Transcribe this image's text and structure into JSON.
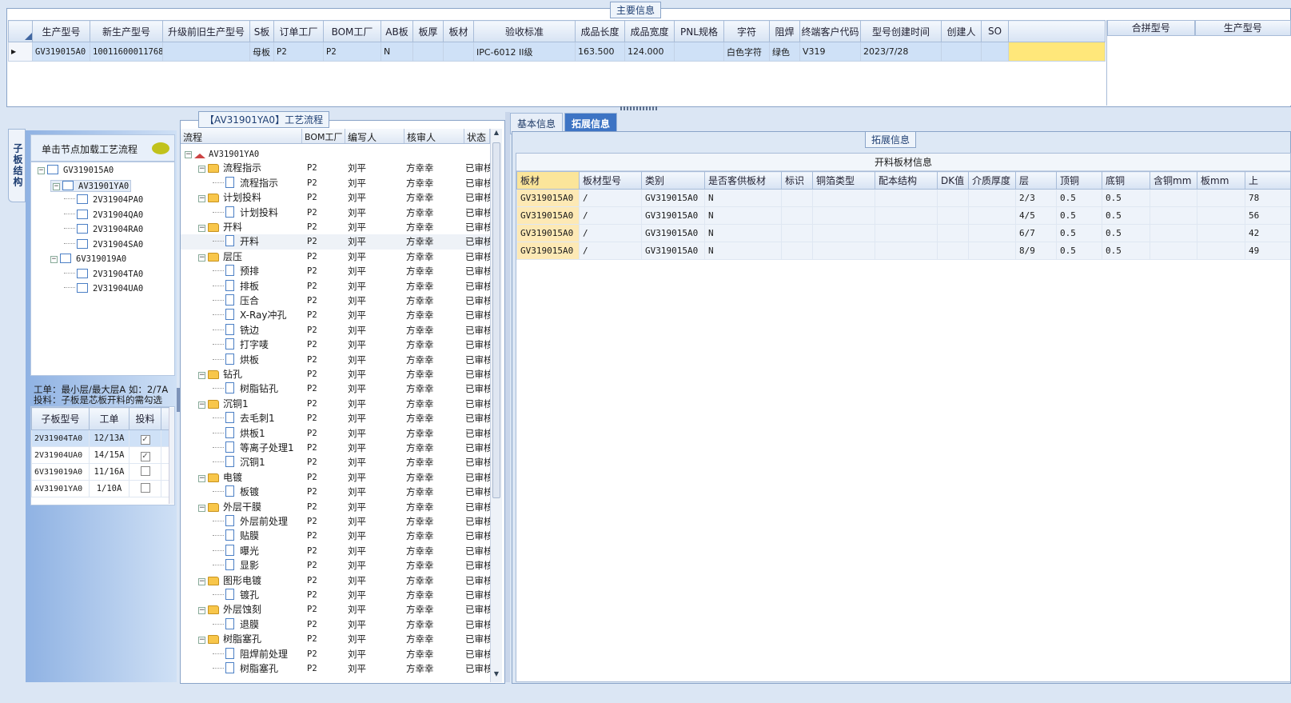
{
  "main_info": {
    "title": "主要信息",
    "columns": [
      "生产型号",
      "新生产型号",
      "升级前旧生产型号",
      "S板",
      "订单工厂",
      "BOM工厂",
      "AB板",
      "板厚",
      "板材",
      "验收标准",
      "成品长度",
      "成品宽度",
      "PNL规格",
      "字符",
      "阻焊",
      "终端客户代码",
      "型号创建时间",
      "创建人",
      "SO"
    ],
    "row": [
      "GV319015A0",
      "10011600011768",
      "",
      "母板",
      "P2",
      "P2",
      "N",
      "",
      "",
      "IPC-6012 II级",
      "163.500",
      "124.000",
      "",
      "白色字符",
      "绿色",
      "V319",
      "2023/7/28",
      "",
      ""
    ],
    "right_columns": [
      "合拼型号",
      "生产型号"
    ]
  },
  "left_panel": {
    "vertical_tab": "子板结构",
    "header": "单击节点加载工艺流程",
    "tree": [
      {
        "label": "GV319015A0",
        "level": 0
      },
      {
        "label": "AV31901YA0",
        "level": 1
      },
      {
        "label": "2V31904PA0",
        "level": 2
      },
      {
        "label": "2V31904QA0",
        "level": 2
      },
      {
        "label": "2V31904RA0",
        "level": 2
      },
      {
        "label": "2V31904SA0",
        "level": 2
      },
      {
        "label": "6V319019A0",
        "level": 1
      },
      {
        "label": "2V31904TA0",
        "level": 2
      },
      {
        "label": "2V31904UA0",
        "level": 2
      }
    ],
    "note1": "工单：最小层/最大层A 如：2/7A",
    "note2": "投料：子板是芯板开料的需勾选",
    "sub_columns": [
      "子板型号",
      "工单",
      "投料"
    ],
    "sub_rows": [
      {
        "model": "2V31904TA0",
        "order": "12/13A",
        "checked": true
      },
      {
        "model": "2V31904UA0",
        "order": "14/15A",
        "checked": true
      },
      {
        "model": "6V319019A0",
        "order": "11/16A",
        "checked": false
      },
      {
        "model": "AV31901YA0",
        "order": "1/10A",
        "checked": false
      }
    ]
  },
  "process_panel": {
    "title": "【AV31901YA0】工艺流程",
    "columns": [
      "流程",
      "BOM工厂",
      "编写人",
      "核审人",
      "状态"
    ],
    "root": "AV31901YA0",
    "rows": [
      {
        "label": "流程指示",
        "type": "folder"
      },
      {
        "label": "流程指示",
        "type": "doc"
      },
      {
        "label": "计划投料",
        "type": "folder"
      },
      {
        "label": "计划投料",
        "type": "doc"
      },
      {
        "label": "开料",
        "type": "folder"
      },
      {
        "label": "开料",
        "type": "doc"
      },
      {
        "label": "层压",
        "type": "folder"
      },
      {
        "label": "预排",
        "type": "doc"
      },
      {
        "label": "排板",
        "type": "doc"
      },
      {
        "label": "压合",
        "type": "doc"
      },
      {
        "label": "X-Ray冲孔",
        "type": "doc"
      },
      {
        "label": "铣边",
        "type": "doc"
      },
      {
        "label": "打字唛",
        "type": "doc"
      },
      {
        "label": "烘板",
        "type": "doc"
      },
      {
        "label": "钻孔",
        "type": "folder"
      },
      {
        "label": "树脂钻孔",
        "type": "doc"
      },
      {
        "label": "沉铜1",
        "type": "folder"
      },
      {
        "label": "去毛刺1",
        "type": "doc"
      },
      {
        "label": "烘板1",
        "type": "doc"
      },
      {
        "label": "等离子处理1",
        "type": "doc"
      },
      {
        "label": "沉铜1",
        "type": "doc"
      },
      {
        "label": "电镀",
        "type": "folder"
      },
      {
        "label": "板镀",
        "type": "doc"
      },
      {
        "label": "外层干膜",
        "type": "folder"
      },
      {
        "label": "外层前处理",
        "type": "doc"
      },
      {
        "label": "贴膜",
        "type": "doc"
      },
      {
        "label": "曝光",
        "type": "doc"
      },
      {
        "label": "显影",
        "type": "doc"
      },
      {
        "label": "图形电镀",
        "type": "folder"
      },
      {
        "label": "镀孔",
        "type": "doc"
      },
      {
        "label": "外层蚀刻",
        "type": "folder"
      },
      {
        "label": "退膜",
        "type": "doc"
      },
      {
        "label": "树脂塞孔",
        "type": "folder"
      },
      {
        "label": "阻焊前处理",
        "type": "doc"
      },
      {
        "label": "树脂塞孔",
        "type": "doc"
      }
    ],
    "bom": "P2",
    "writer": "刘平",
    "reviewer": "方幸幸",
    "status": "已审核"
  },
  "right_panel": {
    "tabs": [
      "基本信息",
      "拓展信息"
    ],
    "active_tab": 1,
    "group_title": "拓展信息",
    "table_title": "开料板材信息",
    "columns": [
      "板材",
      "板材型号",
      "类别",
      "是否客供板材",
      "标识",
      "铜箔类型",
      "配本结构",
      "DK值",
      "介质厚度",
      "层",
      "顶铜",
      "底铜",
      "含铜mm",
      "板mm",
      "上"
    ],
    "rows": [
      [
        "GV319015A0",
        "/",
        "GV319015A0",
        "N",
        "",
        "",
        "",
        "",
        "",
        "2/3",
        "0.5",
        "0.5",
        "",
        "",
        "78"
      ],
      [
        "GV319015A0",
        "/",
        "GV319015A0",
        "N",
        "",
        "",
        "",
        "",
        "",
        "4/5",
        "0.5",
        "0.5",
        "",
        "",
        "56"
      ],
      [
        "GV319015A0",
        "/",
        "GV319015A0",
        "N",
        "",
        "",
        "",
        "",
        "",
        "6/7",
        "0.5",
        "0.5",
        "",
        "",
        "42"
      ],
      [
        "GV319015A0",
        "/",
        "GV319015A0",
        "N",
        "",
        "",
        "",
        "",
        "",
        "8/9",
        "0.5",
        "0.5",
        "",
        "",
        "49"
      ]
    ]
  }
}
